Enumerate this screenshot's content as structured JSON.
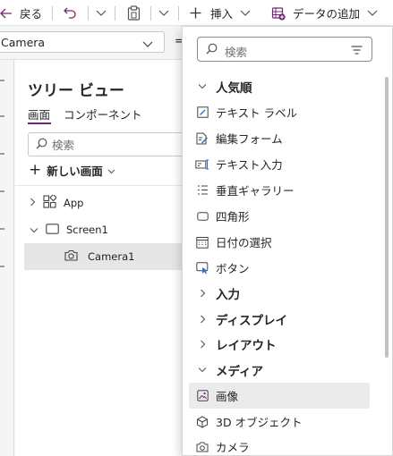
{
  "toolbar": {
    "back_label": "戻る",
    "insert_label": "挿入",
    "add_data_label": "データの追加"
  },
  "property": {
    "selected_control": "Camera",
    "formula_fragment": "="
  },
  "tree": {
    "title": "ツリー ビュー",
    "tabs": [
      "画面",
      "コンポーネント"
    ],
    "search_placeholder": "検索",
    "new_screen_label": "新しい画面",
    "nodes": [
      "App",
      "Screen1",
      "Camera1"
    ]
  },
  "insert_menu": {
    "search_placeholder": "検索",
    "items": [
      {
        "label": "人気順",
        "type": "category",
        "expanded": true,
        "icon": "chevron-down-icon"
      },
      {
        "label": "テキスト ラベル",
        "type": "control",
        "icon": "text-label-icon"
      },
      {
        "label": "編集フォーム",
        "type": "control",
        "icon": "edit-form-icon"
      },
      {
        "label": "テキスト入力",
        "type": "control",
        "icon": "text-input-icon"
      },
      {
        "label": "垂直ギャラリー",
        "type": "control",
        "icon": "vertical-gallery-icon"
      },
      {
        "label": "四角形",
        "type": "control",
        "icon": "rectangle-icon"
      },
      {
        "label": "日付の選択",
        "type": "control",
        "icon": "date-picker-icon"
      },
      {
        "label": "ボタン",
        "type": "control",
        "icon": "button-icon"
      },
      {
        "label": "入力",
        "type": "category",
        "expanded": false,
        "icon": "chevron-right-icon"
      },
      {
        "label": "ディスプレイ",
        "type": "category",
        "expanded": false,
        "icon": "chevron-right-icon"
      },
      {
        "label": "レイアウト",
        "type": "category",
        "expanded": false,
        "icon": "chevron-right-icon"
      },
      {
        "label": "メディア",
        "type": "category",
        "expanded": true,
        "icon": "chevron-down-icon"
      },
      {
        "label": "画像",
        "type": "control",
        "icon": "image-icon",
        "highlighted": true
      },
      {
        "label": "3D オブジェクト",
        "type": "control",
        "icon": "3d-object-icon"
      },
      {
        "label": "カメラ",
        "type": "control",
        "icon": "camera-icon"
      }
    ]
  },
  "colors": {
    "accent": "#742774",
    "highlight_row": "#ebebeb",
    "selected_tree_row": "#e6e6e6"
  }
}
